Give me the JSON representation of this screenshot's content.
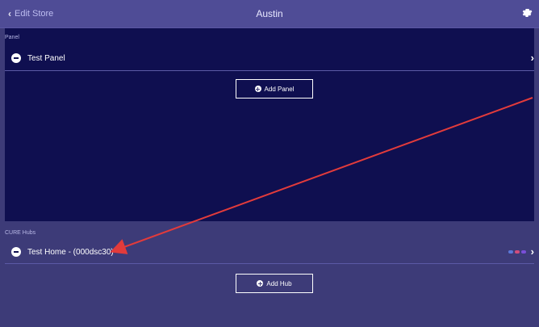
{
  "header": {
    "back_label": "Edit Store",
    "title": "Austin"
  },
  "panels": {
    "section_label": "Panel",
    "items": [
      {
        "label": "Test Panel"
      }
    ],
    "add_button_label": "Add Panel"
  },
  "hubs": {
    "section_label": "CURE Hubs",
    "items": [
      {
        "label": "Test Home - (000dsc30)"
      }
    ],
    "add_button_label": "Add Hub"
  },
  "colors": {
    "top_bar": "#4f4c96",
    "dark_section": "#0f0f50",
    "lower_background": "#3d3b78",
    "annotation_arrow": "#e23b3b"
  },
  "icons": [
    "chevron-left-icon",
    "gear-icon",
    "minus-circle-icon",
    "chevron-right-icon",
    "plus-circle-icon"
  ]
}
